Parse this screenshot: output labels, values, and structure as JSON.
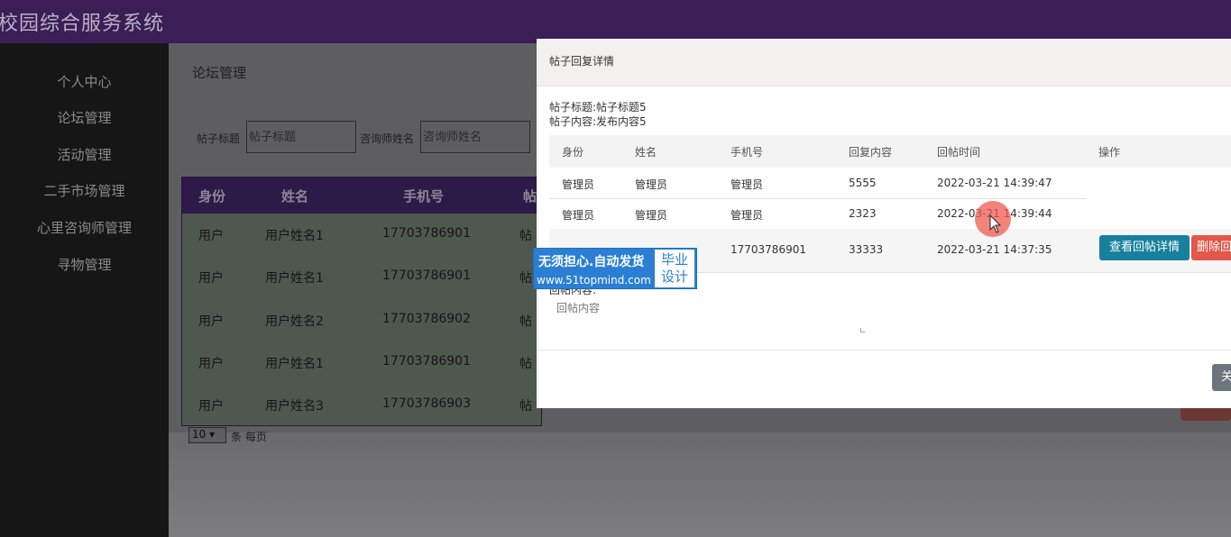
{
  "app": {
    "title": "校园综合服务系统"
  },
  "sidebar": {
    "items": [
      {
        "label": "个人中心"
      },
      {
        "label": "论坛管理"
      },
      {
        "label": "活动管理"
      },
      {
        "label": "二手市场管理"
      },
      {
        "label": "心里咨询师管理"
      },
      {
        "label": "寻物管理"
      }
    ]
  },
  "page": {
    "title": "论坛管理"
  },
  "search": {
    "post_title_label": "帖子标题",
    "post_title_placeholder": "帖子标题",
    "consultant_label": "咨询师姓名",
    "consultant_placeholder": "咨询师姓名"
  },
  "table": {
    "headers": [
      "身份",
      "姓名",
      "手机号",
      "帖"
    ],
    "rows": [
      [
        "用户",
        "用户姓名1",
        "17703786901",
        "帖"
      ],
      [
        "用户",
        "用户姓名1",
        "17703786901",
        "帖"
      ],
      [
        "用户",
        "用户姓名2",
        "17703786902",
        "帖"
      ],
      [
        "用户",
        "用户姓名1",
        "17703786901",
        "帖"
      ],
      [
        "用户",
        "用户姓名3",
        "17703786903",
        "帖"
      ]
    ]
  },
  "pagination": {
    "page_size": "10",
    "suffix": "条 每页"
  },
  "modal": {
    "title": "帖子回复详情",
    "post_title": "帖子标题:帖子标题5",
    "post_content": "帖子内容:发布内容5",
    "headers": [
      "身份",
      "姓名",
      "手机号",
      "回复内容",
      "回帖时间",
      "操作"
    ],
    "rows": [
      [
        "管理员",
        "管理员",
        "管理员",
        "5555",
        "2022-03-21 14:39:47"
      ],
      [
        "管理员",
        "管理员",
        "管理员",
        "2323",
        "2022-03-21 14:39:44"
      ],
      [
        "",
        "",
        "17703786901",
        "33333",
        "2022-03-21 14:37:35"
      ]
    ],
    "view_button": "查看回帖详情",
    "delete_button": "删除回",
    "reply_label": "回帖内容:",
    "reply_placeholder": "回帖内容",
    "close_button": "关"
  },
  "watermark": {
    "line1": "无须担心.自动发货",
    "line2": "www.51topmind.com",
    "badge_line1": "毕业",
    "badge_line2": "设计"
  },
  "colors": {
    "topbar": "#3b1e56",
    "sidebar": "#161616",
    "table_header": "#2e1a48",
    "view_button": "#17809c",
    "delete_button": "#e2584b",
    "watermark": "#2a7fd4"
  }
}
